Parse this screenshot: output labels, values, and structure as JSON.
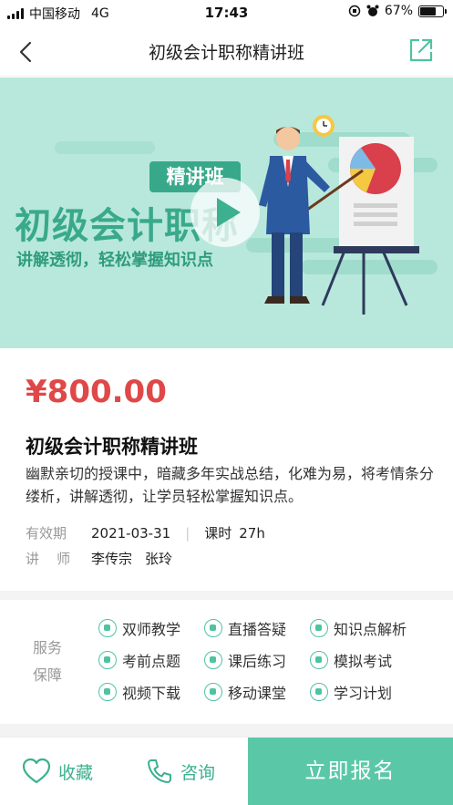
{
  "status_bar": {
    "carrier": "中国移动",
    "network": "4G",
    "time": "17:43",
    "battery": "67%",
    "battery_level": 0.67
  },
  "nav": {
    "title": "初级会计职称精讲班"
  },
  "banner": {
    "tag": "精讲班",
    "title": "初级会计职称",
    "subtitle": "讲解透彻，轻松掌握知识点"
  },
  "course": {
    "price": "¥800.00",
    "title": "初级会计职称精讲班",
    "description": "幽默亲切的授课中，暗藏多年实战总结，化难为易，将考情条分缕析，讲解透彻，让学员轻松掌握知识点。",
    "validity_label": "有效期",
    "validity_value": "2021-03-31",
    "hours_label": "课时",
    "hours_value": "27h",
    "teacher_label": "讲    师",
    "teacher_1": "李传宗",
    "teacher_2": "张玲"
  },
  "services": {
    "label_line1": "服务",
    "label_line2": "保障",
    "items": [
      {
        "label": "双师教学"
      },
      {
        "label": "直播答疑"
      },
      {
        "label": "知识点解析"
      },
      {
        "label": "考前点题"
      },
      {
        "label": "课后练习"
      },
      {
        "label": "模拟考试"
      },
      {
        "label": "视频下载"
      },
      {
        "label": "移动课堂"
      },
      {
        "label": "学习计划"
      }
    ]
  },
  "bottom_bar": {
    "favorite": "收藏",
    "consult": "咨询",
    "enroll": "立即报名"
  },
  "colors": {
    "accent": "#5ac8a6",
    "price": "#e04848",
    "banner_bg": "#b8e8dc"
  }
}
